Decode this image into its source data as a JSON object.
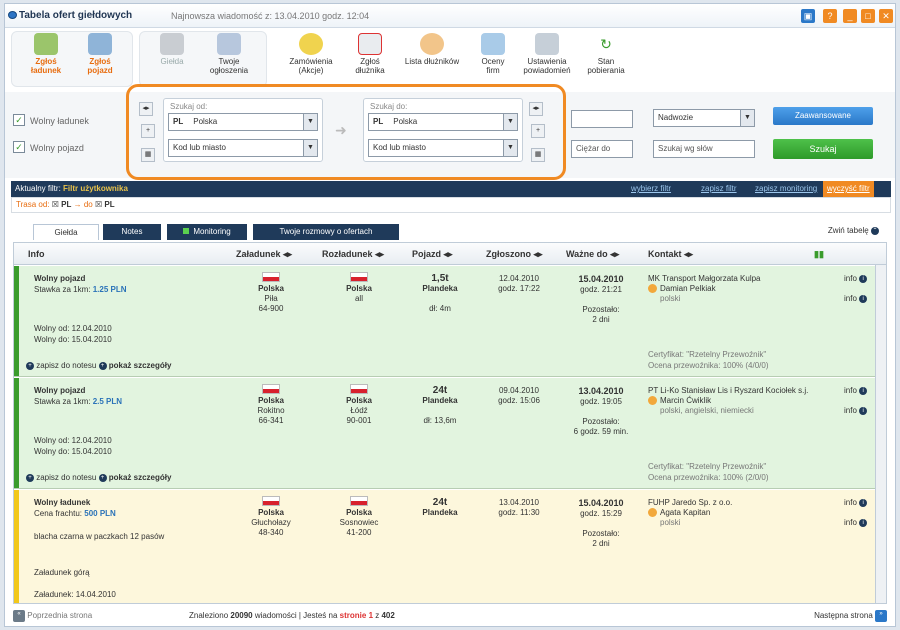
{
  "app": {
    "title": "Tabela ofert giełdowych",
    "newest": "Najnowsza wiadomość z: 13.04.2010 godz. 12:04"
  },
  "toolbar": {
    "add_load": [
      "Zgłoś",
      "ładunek"
    ],
    "add_vehicle": [
      "Zgłoś",
      "pojazd"
    ],
    "exchange": "Giełda",
    "my_ads": [
      "Twoje",
      "ogłoszenia"
    ],
    "orders": [
      "Zamówienia",
      "(Akcje)"
    ],
    "report_debtor": [
      "Zgłoś",
      "dłużnika"
    ],
    "debtor_list": "Lista dłużników",
    "ratings": [
      "Oceny",
      "firm"
    ],
    "notif_settings": [
      "Ustawienia",
      "powiadomień"
    ],
    "download_state": [
      "Stan",
      "pobierania"
    ]
  },
  "search": {
    "free_load": "Wolny ładunek",
    "free_vehicle": "Wolny pojazd",
    "from_label": "Szukaj od:",
    "to_label": "Szukaj do:",
    "from_country_code": "PL",
    "from_country": "Polska",
    "from_city": "Kod lub miasto",
    "to_country_code": "PL",
    "to_country": "Polska",
    "to_city": "Kod lub miasto",
    "weight_to": "Ciężar do",
    "body_type": "Nadwozie",
    "keyword": "Szukaj wg słów",
    "advanced": "Zaawansowane",
    "search_btn": "Szukaj"
  },
  "filter": {
    "label": "Aktualny filtr:",
    "name": "Filtr użytkownika",
    "choose": "wybierz filtr",
    "save": "zapisz filtr",
    "save_monitoring": "zapisz monitoring",
    "clear": "wyczyść filtr",
    "route_label": "Trasa od:",
    "route_from": "PL",
    "route_to_label": "do",
    "route_to": "PL"
  },
  "tabs": [
    "Giełda",
    "Notes",
    "Monitoring",
    "Twoje rozmowy o ofertach"
  ],
  "collapse": "Zwiń tabelę",
  "columns": [
    "Info",
    "Załadunek",
    "Rozładunek",
    "Pojazd",
    "Zgłoszono",
    "Ważne do",
    "Kontakt"
  ],
  "rows": [
    {
      "title": "Wolny pojazd",
      "rate_label": "Stawka za 1km:",
      "rate": "1.25 PLN",
      "extra": "",
      "line1": "Wolny od: 12.04.2010",
      "line2": "Wolny do: 15.04.2010",
      "load_country": "Polska",
      "load_city": "Piła",
      "load_code": "64-900",
      "unload_country": "Polska",
      "unload_city": "all",
      "unload_code": "",
      "vehicle": "1,5t",
      "vehicle_type": "Plandeka",
      "dims": "dł: 4m",
      "posted": "12.04.2010",
      "posted_time": "godz. 17:22",
      "valid": "15.04.2010",
      "valid_time": "godz. 21:21",
      "left_label": "Pozostało:",
      "left": "2 dni",
      "company": "MK Transport Małgorzata Kulpa",
      "person": "Damian Pelkiak",
      "langs": "polski",
      "cert": "Certyfikat: \"Rzetelny Przewoźnik\"",
      "rating": "Ocena przewoźnika: 100% (4/0/0)",
      "note": "zapisz do notesu",
      "details": "pokaż szczegóły",
      "info": "info"
    },
    {
      "title": "Wolny pojazd",
      "rate_label": "Stawka za 1km:",
      "rate": "2.5 PLN",
      "extra": "",
      "line1": "Wolny od: 12.04.2010",
      "line2": "Wolny do: 15.04.2010",
      "load_country": "Polska",
      "load_city": "Rokitno",
      "load_code": "66-341",
      "unload_country": "Polska",
      "unload_city": "Łódź",
      "unload_code": "90-001",
      "vehicle": "24t",
      "vehicle_type": "Plandeka",
      "dims": "dł: 13,6m",
      "posted": "09.04.2010",
      "posted_time": "godz. 15:06",
      "valid": "13.04.2010",
      "valid_time": "godz. 19:05",
      "left_label": "Pozostało:",
      "left": "6 godz. 59 min.",
      "company": "PT Li-Ko Stanisław Lis i Ryszard Kociołek s.j.",
      "person": "Marcin Ćwiklik",
      "langs": "polski, angielski, niemiecki",
      "cert": "Certyfikat: \"Rzetelny Przewoźnik\"",
      "rating": "Ocena przewoźnika: 100% (2/0/0)",
      "note": "zapisz do notesu",
      "details": "pokaż szczegóły",
      "info": "info"
    },
    {
      "title": "Wolny ładunek",
      "rate_label": "Cena frachtu:",
      "rate": "500 PLN",
      "extra": "blacha czarna w paczkach 12 pasów",
      "line1": "Załadunek górą",
      "line2": "Załadunek: 14.04.2010",
      "load_country": "Polska",
      "load_city": "Głuchołazy",
      "load_code": "48-340",
      "unload_country": "Polska",
      "unload_city": "Sosnowiec",
      "unload_code": "41-200",
      "vehicle": "24t",
      "vehicle_type": "Plandeka",
      "dims": "",
      "posted": "13.04.2010",
      "posted_time": "godz. 11:30",
      "valid": "15.04.2010",
      "valid_time": "godz. 15:29",
      "left_label": "Pozostało:",
      "left": "2 dni",
      "company": "FUHP Jaredo Sp. z o.o.",
      "person": "Agata Kapitan",
      "langs": "polski",
      "cert": "",
      "rating": "",
      "note": "",
      "details": "",
      "info": "info"
    }
  ],
  "footer": {
    "prev": "Poprzednia strona",
    "found_pre": "Znaleziono",
    "found": "20090",
    "found_mid": "wiadomości | Jesteś na",
    "page_word": "stronie",
    "page": "1",
    "of": "z",
    "pages": "402",
    "next": "Następna strona"
  }
}
